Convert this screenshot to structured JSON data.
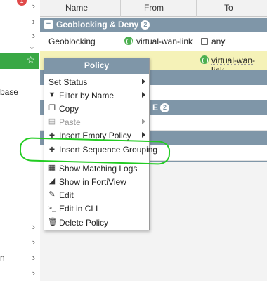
{
  "sidebar": {
    "notification_count": "1",
    "partial_labels": [
      "base",
      "n"
    ]
  },
  "table": {
    "columns": [
      "Name",
      "From",
      "To"
    ],
    "group1": {
      "label": "Geoblocking & Deny",
      "count": "2"
    },
    "row1": {
      "name": "Geoblocking",
      "from": "virtual-wan-link",
      "to": "any"
    },
    "row2": {
      "to": "virtual-wan-link"
    },
    "group2": {
      "label_tail": "E",
      "count": "2"
    }
  },
  "menu": {
    "title": "Policy",
    "items": [
      {
        "label": "Set Status",
        "icon": "",
        "submenu": true,
        "enabled": true
      },
      {
        "label": "Filter by Name",
        "icon": "filter-icon",
        "submenu": true,
        "enabled": true
      },
      {
        "label": "Copy",
        "icon": "copy-icon",
        "submenu": false,
        "enabled": true
      },
      {
        "label": "Paste",
        "icon": "paste-icon",
        "submenu": true,
        "enabled": false
      },
      {
        "label": "Insert Empty Policy",
        "icon": "plus-icon",
        "submenu": true,
        "enabled": true
      },
      {
        "label": "Insert Sequence Grouping",
        "icon": "plus-icon",
        "submenu": false,
        "enabled": true
      },
      {
        "label": "Show Matching Logs",
        "icon": "logs-icon",
        "submenu": false,
        "enabled": true
      },
      {
        "label": "Show in FortiView",
        "icon": "chart-icon",
        "submenu": false,
        "enabled": true
      },
      {
        "label": "Edit",
        "icon": "edit-icon",
        "submenu": false,
        "enabled": true
      },
      {
        "label": "Edit in CLI",
        "icon": "cli-icon",
        "submenu": false,
        "enabled": true
      },
      {
        "label": "Delete Policy",
        "icon": "trash-icon",
        "submenu": false,
        "enabled": true
      }
    ]
  },
  "colors": {
    "group_header": "#7f96a8",
    "selected_row": "#f5f2b8",
    "sidebar_active": "#39a845",
    "annotation": "#22cc22"
  }
}
